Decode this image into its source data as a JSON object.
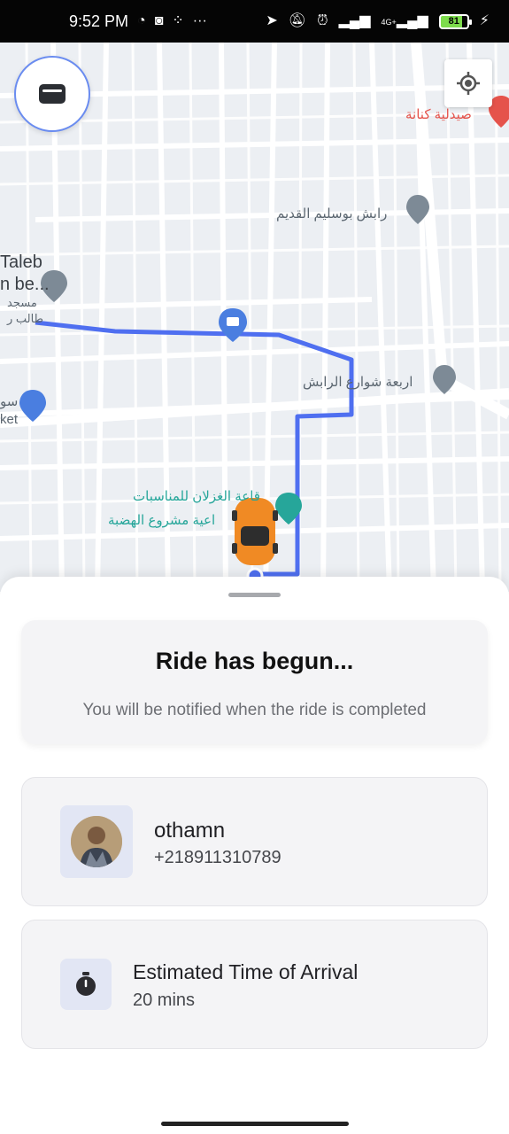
{
  "status_bar": {
    "time": "9:52 PM",
    "left_icons": [
      "whatsapp-icon",
      "game-controller-icon",
      "settings-dots-icon",
      "more-icon"
    ],
    "right_icons": [
      "navigation-icon",
      "mute-icon",
      "alarm-icon",
      "signal-icon",
      "4g-signal-icon"
    ],
    "network_label": "4G+",
    "battery_level": "81",
    "charging_icon": "⚡"
  },
  "map": {
    "labels": {
      "pharmacy": "صيدلية كنانة",
      "rabash_old": "رابش بوسليم القديم",
      "taleb_1": "Taleb",
      "taleb_2": "n be...",
      "mosque_1": "مسجد",
      "mosque_2": "طالب ر",
      "four_streets": "اربعة شوارع الرابش",
      "supermarket_1": "سو",
      "supermarket_2": "ket",
      "ghezlan": "قاعة الغزلان للمناسبات",
      "hadaba": "اعية مشروع الهضبة"
    },
    "route_color": "#4f6ff0",
    "car_color": "#f08a24"
  },
  "wallet_button": {
    "icon": "wallet-icon"
  },
  "locate_button": {
    "icon": "my-location-icon"
  },
  "ride_status": {
    "title": "Ride has begun...",
    "subtitle": "You will be notified when the ride is completed"
  },
  "driver": {
    "name": "othamn",
    "phone": "+218911310789"
  },
  "eta": {
    "label": "Estimated Time of Arrival",
    "value": "20 mins",
    "icon": "stopwatch-icon"
  }
}
